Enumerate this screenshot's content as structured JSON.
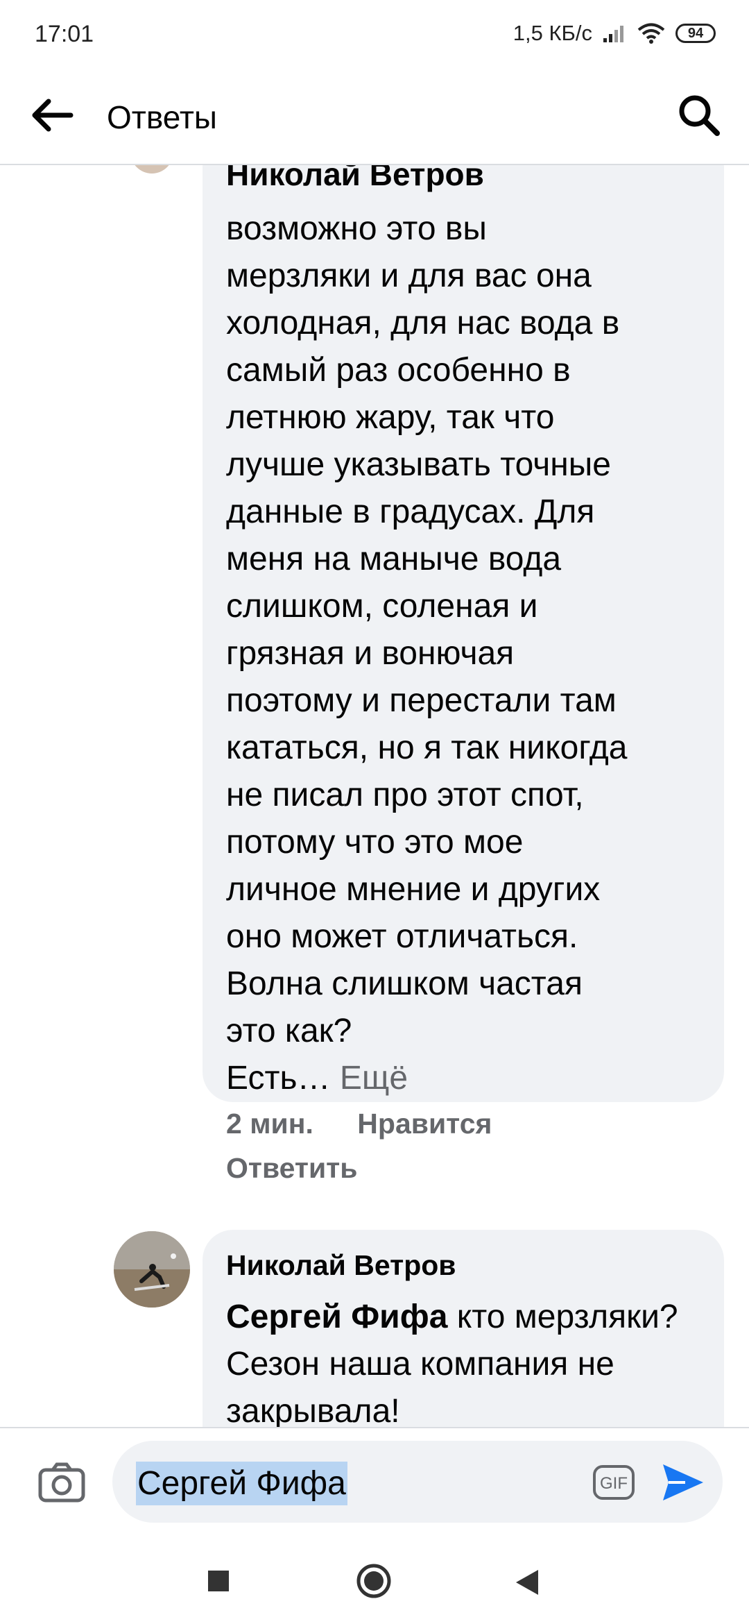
{
  "status": {
    "time": "17:01",
    "network_speed": "1,5 КБ/с",
    "battery": "94"
  },
  "header": {
    "title": "Ответы"
  },
  "comments": [
    {
      "author": "Николай Ветров",
      "text": "возможно это вы\nмерзляки и для вас она\nхолодная, для нас вода в\nсамый раз особенно в\nлетнюю жару, так что\nлучше указывать точные\nданные в градусах.  Для\nменя на маныче вода\nслишком, соленая и\nгрязная и вонючая\nпоэтому и перестали там\nкататься, но я так никогда\nне писал про этот спот,\nпотому что это мое\nличное мнение и других\nоно может отличаться.\nВолна слишком частая\nэто как?\nЕсть…",
      "more_label": "Ещё",
      "time": "2 мин.",
      "like_label": "Нравится",
      "reply_label": "Ответить"
    },
    {
      "author": "Николай Ветров",
      "mention": "Сергей Фифа",
      "text": " кто мерзляки? Сезон наша компания не закрывала!"
    }
  ],
  "composer": {
    "value": "Сергей Фифа",
    "gif_label": "GIF"
  },
  "colors": {
    "accent": "#1877f2",
    "bubble": "#f0f2f5",
    "meta": "#65676b",
    "selection": "#b8d4f2"
  }
}
